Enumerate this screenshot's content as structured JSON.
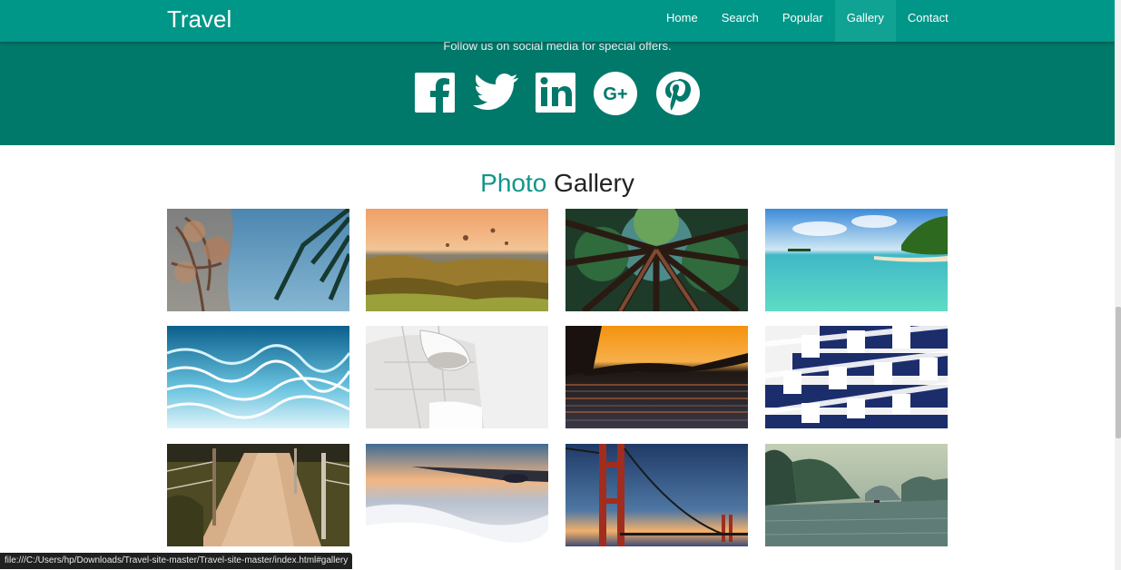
{
  "brand": "Travel",
  "nav": [
    {
      "label": "Home",
      "active": false
    },
    {
      "label": "Search",
      "active": false
    },
    {
      "label": "Popular",
      "active": false
    },
    {
      "label": "Gallery",
      "active": true
    },
    {
      "label": "Contact",
      "active": false
    }
  ],
  "social": {
    "text": "Follow us on social media for special offers.",
    "icons": [
      "facebook-icon",
      "twitter-icon",
      "linkedin-icon",
      "google-plus-icon",
      "pinterest-icon"
    ]
  },
  "gallery": {
    "title_accent": "Photo",
    "title_rest": "Gallery",
    "photos": [
      "tree-palm-sky-photo",
      "balloons-valley-photo",
      "forest-canopy-photo",
      "tropical-beach-photo",
      "underwater-ripples-photo",
      "white-architecture-photo",
      "sunset-lake-photo",
      "cruise-balconies-photo",
      "sandy-path-fence-photo",
      "airplane-wing-clouds-photo",
      "golden-gate-bridge-photo",
      "bay-karst-islands-photo"
    ]
  },
  "status_url": "file:///C:/Users/hp/Downloads/Travel-site-master/Travel-site-master/index.html#gallery",
  "colors": {
    "navbar": "#009688",
    "social_band": "#00796b",
    "accent": "#12968a"
  }
}
